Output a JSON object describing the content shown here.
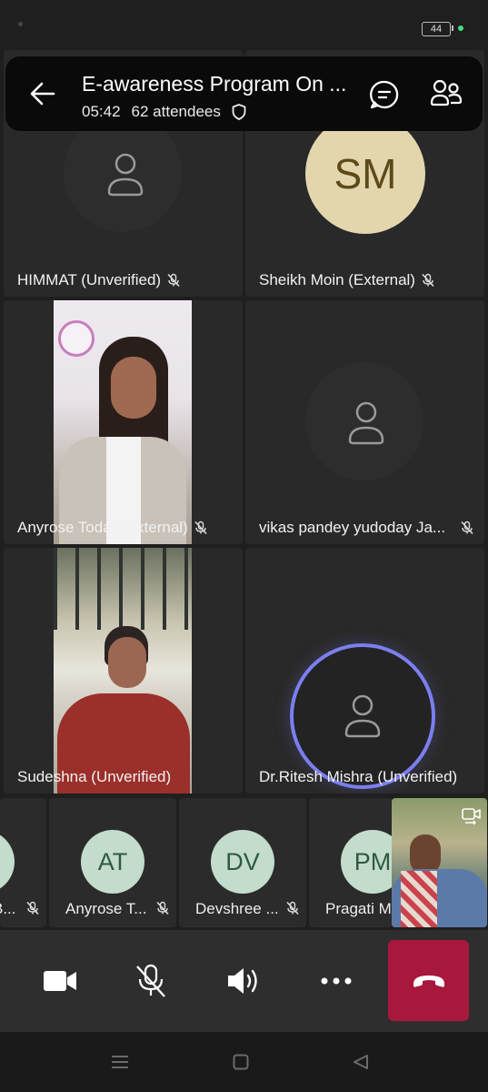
{
  "status": {
    "battery": "44"
  },
  "header": {
    "title": "E-awareness Program On ...",
    "duration": "05:42",
    "attendees": "62 attendees"
  },
  "tiles": [
    {
      "name": "HIMMAT (Unverified)"
    },
    {
      "name": "Sheikh Moin (External)",
      "initials": "SM"
    },
    {
      "name": "Anyrose Todar (External)"
    },
    {
      "name": "vikas pandey yudoday Ja..."
    },
    {
      "name": "Sudeshna  (Unverified)"
    },
    {
      "name": "Dr.Ritesh Mishra (Unverified)"
    }
  ],
  "strip": [
    {
      "name": "B..."
    },
    {
      "name": "Anyrose T...",
      "initials": "AT"
    },
    {
      "name": "Devshree ...",
      "initials": "DV"
    },
    {
      "name": "Pragati M...",
      "initials": "PM"
    }
  ],
  "colors": {
    "end_call": "#a8183c",
    "active_speaker_ring": "#7b7ff0",
    "sm_avatar": "#e3d6ad",
    "strip_avatar": "#c3dccb"
  }
}
